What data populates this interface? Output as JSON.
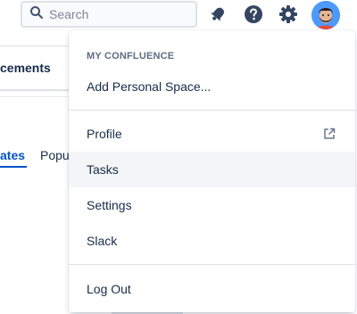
{
  "header": {
    "search_placeholder": "Search"
  },
  "background": {
    "heading": "cements",
    "tabs": [
      "ates",
      "Popu"
    ]
  },
  "menu": {
    "section_title": "MY CONFLUENCE",
    "add_space": "Add Personal Space...",
    "profile": "Profile",
    "tasks": "Tasks",
    "settings": "Settings",
    "slack": "Slack",
    "logout": "Log Out"
  },
  "colors": {
    "accent": "#0052cc",
    "nav_icon": "#344563",
    "hover_bg": "#f4f5f7"
  },
  "icons": [
    "search-icon",
    "notification-bell-icon",
    "help-icon",
    "settings-gear-icon",
    "external-link-icon"
  ]
}
